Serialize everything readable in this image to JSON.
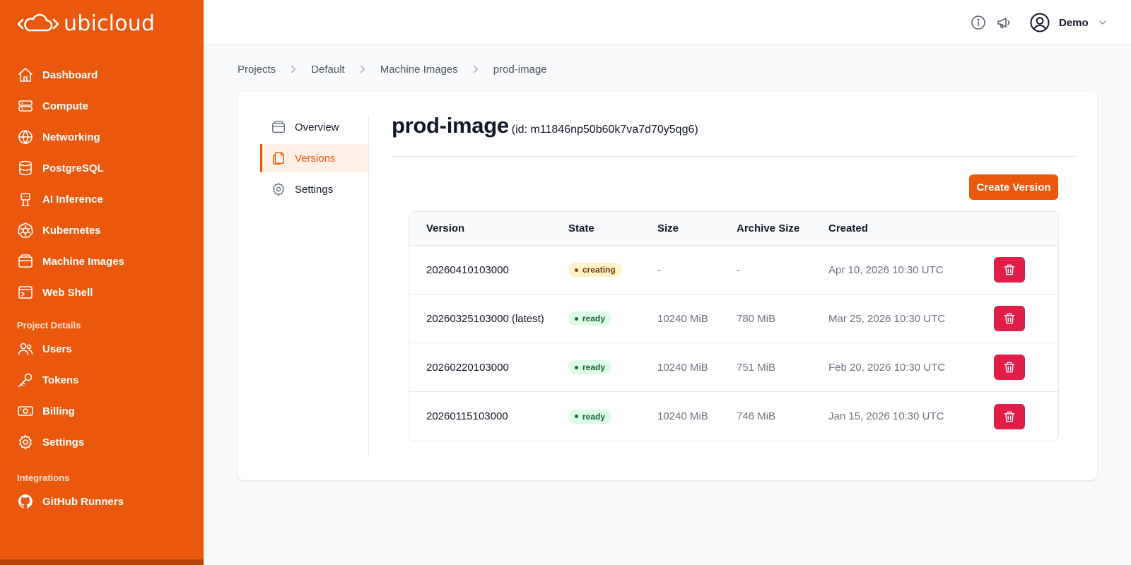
{
  "brand": {
    "name": "ubicloud",
    "accent": "#e9580c"
  },
  "sidebar": {
    "items": [
      {
        "label": "Dashboard",
        "icon": "home-icon"
      },
      {
        "label": "Compute",
        "icon": "server-icon"
      },
      {
        "label": "Networking",
        "icon": "globe-icon"
      },
      {
        "label": "PostgreSQL",
        "icon": "database-icon"
      },
      {
        "label": "AI Inference",
        "icon": "robot-icon"
      },
      {
        "label": "Kubernetes",
        "icon": "kubernetes-icon"
      },
      {
        "label": "Machine Images",
        "icon": "archive-icon"
      },
      {
        "label": "Web Shell",
        "icon": "terminal-icon"
      }
    ],
    "project_section": "Project Details",
    "project_items": [
      {
        "label": "Users",
        "icon": "users-icon"
      },
      {
        "label": "Tokens",
        "icon": "key-icon"
      },
      {
        "label": "Billing",
        "icon": "banknote-icon"
      },
      {
        "label": "Settings",
        "icon": "gear-icon"
      }
    ],
    "integrations_section": "Integrations",
    "integration_items": [
      {
        "label": "GitHub Runners",
        "icon": "github-icon"
      }
    ]
  },
  "topbar": {
    "user_name": "Demo"
  },
  "breadcrumb": [
    "Projects",
    "Default",
    "Machine Images",
    "prod-image"
  ],
  "subnav": {
    "items": [
      {
        "label": "Overview",
        "icon": "archive-icon"
      },
      {
        "label": "Versions",
        "icon": "documents-icon",
        "active": true
      },
      {
        "label": "Settings",
        "icon": "gear-icon"
      }
    ]
  },
  "page": {
    "title": "prod-image",
    "id_text": "(id: m11846np50b60k7va7d70y5qg6)",
    "create_button": "Create Version"
  },
  "table": {
    "headers": [
      "Version",
      "State",
      "Size",
      "Archive Size",
      "Created"
    ],
    "rows": [
      {
        "version": "20260410103000",
        "state": "creating",
        "size": "-",
        "archive_size": "-",
        "created": "Apr 10, 2026 10:30 UTC"
      },
      {
        "version": "20260325103000 (latest)",
        "state": "ready",
        "size": "10240 MiB",
        "archive_size": "780 MiB",
        "created": "Mar 25, 2026 10:30 UTC"
      },
      {
        "version": "20260220103000",
        "state": "ready",
        "size": "10240 MiB",
        "archive_size": "751 MiB",
        "created": "Feb 20, 2026 10:30 UTC"
      },
      {
        "version": "20260115103000",
        "state": "ready",
        "size": "10240 MiB",
        "archive_size": "746 MiB",
        "created": "Jan 15, 2026 10:30 UTC"
      }
    ]
  }
}
